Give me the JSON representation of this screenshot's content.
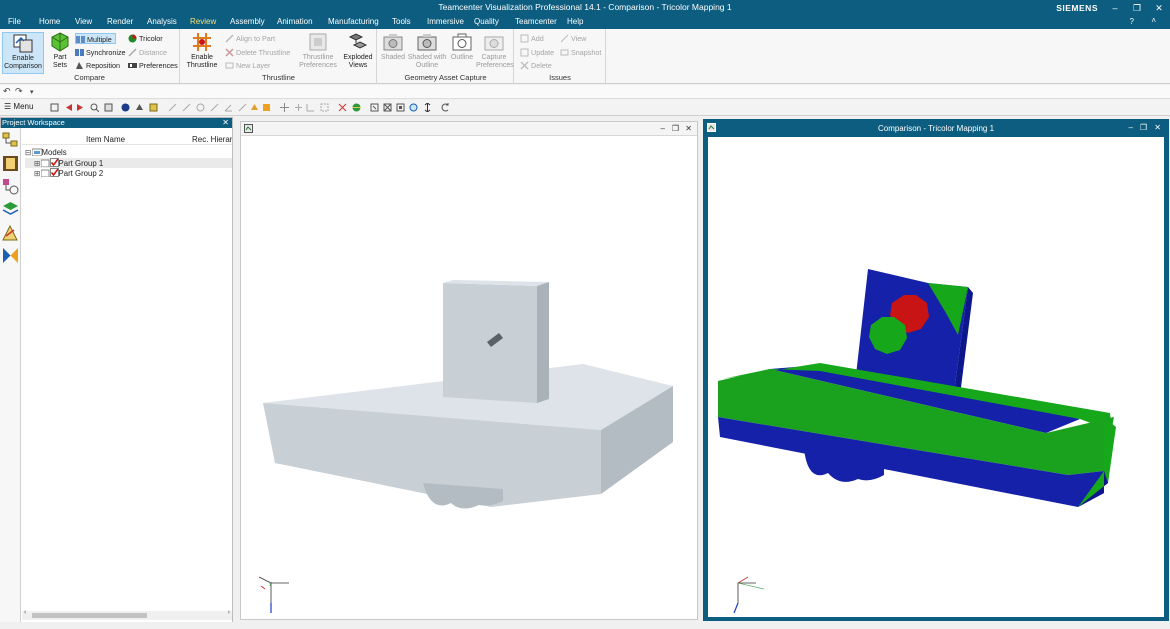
{
  "app": {
    "title": "Teamcenter Visualization Professional 14.1 - Comparison - Tricolor Mapping 1",
    "brand": "SIEMENS"
  },
  "menu": {
    "items": [
      "File",
      "Home",
      "View",
      "Render",
      "Analysis",
      "Review",
      "Assembly",
      "Animation",
      "Manufacturing",
      "Tools",
      "Immersive",
      "Quality",
      "Teamcenter",
      "Help"
    ],
    "active": "Review"
  },
  "ribbon": {
    "compare": {
      "label": "Compare",
      "enable_comparison": "Enable Comparison",
      "part_sets": "Part Sets",
      "multiple": "Multiple",
      "synchronize": "Synchronize",
      "reposition": "Reposition",
      "tricolor": "Tricolor",
      "distance": "Distance",
      "preferences": "Preferences"
    },
    "thrustline": {
      "label": "Thrustline",
      "enable_thrustline": "Enable Thrustline",
      "align_to_part": "Align to Part",
      "delete_thrustline": "Delete Thrustline",
      "new_layer": "New Layer",
      "thrustline_preferences": "Thrustline Preferences",
      "exploded_views": "Exploded Views"
    },
    "gac": {
      "label": "Geometry Asset Capture",
      "shaded": "Shaded",
      "shaded_outline": "Shaded with Outline",
      "outline": "Outline",
      "capture_preferences": "Capture Preferences"
    },
    "issues": {
      "label": "Issues",
      "add": "Add",
      "update": "Update",
      "delete": "Delete",
      "view": "View",
      "snapshot": "Snapshot"
    }
  },
  "toolbar": {
    "menu_label": "Menu"
  },
  "workspace": {
    "title": "Project Workspace",
    "col_item_name": "Item Name",
    "col_rec_hierarchy": "Rec. Hierarc",
    "tree": {
      "root": "Models",
      "children": [
        "Part Group 1",
        "Part Group 2"
      ]
    }
  },
  "viewport2": {
    "title": "Comparison - Tricolor Mapping 1"
  },
  "colors": {
    "title_bar": "#0c5d7f",
    "active_tab": "#f5e07a",
    "part_gray": "#c9d0d6",
    "tricolor_blue": "#1521a8",
    "tricolor_green": "#16a81a",
    "tricolor_red": "#c81414"
  }
}
